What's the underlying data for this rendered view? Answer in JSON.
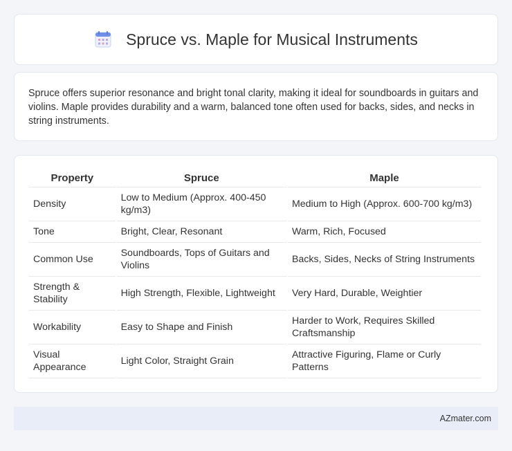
{
  "header": {
    "title": "Spruce vs. Maple for Musical Instruments"
  },
  "intro": {
    "text": "Spruce offers superior resonance and bright tonal clarity, making it ideal for soundboards in guitars and violins. Maple provides durability and a warm, balanced tone often used for backs, sides, and necks in string instruments."
  },
  "table": {
    "headers": [
      "Property",
      "Spruce",
      "Maple"
    ],
    "rows": [
      [
        "Density",
        "Low to Medium (Approx. 400-450 kg/m3)",
        "Medium to High (Approx. 600-700 kg/m3)"
      ],
      [
        "Tone",
        "Bright, Clear, Resonant",
        "Warm, Rich, Focused"
      ],
      [
        "Common Use",
        "Soundboards, Tops of Guitars and Violins",
        "Backs, Sides, Necks of String Instruments"
      ],
      [
        "Strength & Stability",
        "High Strength, Flexible, Lightweight",
        "Very Hard, Durable, Weightier"
      ],
      [
        "Workability",
        "Easy to Shape and Finish",
        "Harder to Work, Requires Skilled Craftsmanship"
      ],
      [
        "Visual Appearance",
        "Light Color, Straight Grain",
        "Attractive Figuring, Flame or Curly Patterns"
      ]
    ]
  },
  "footer": {
    "text": "AZmater.com"
  },
  "icon": {
    "name": "calendar-icon",
    "colors": {
      "header": "#6f8fe8",
      "grid": "#d9c8f0",
      "body": "#eef1fb"
    }
  }
}
